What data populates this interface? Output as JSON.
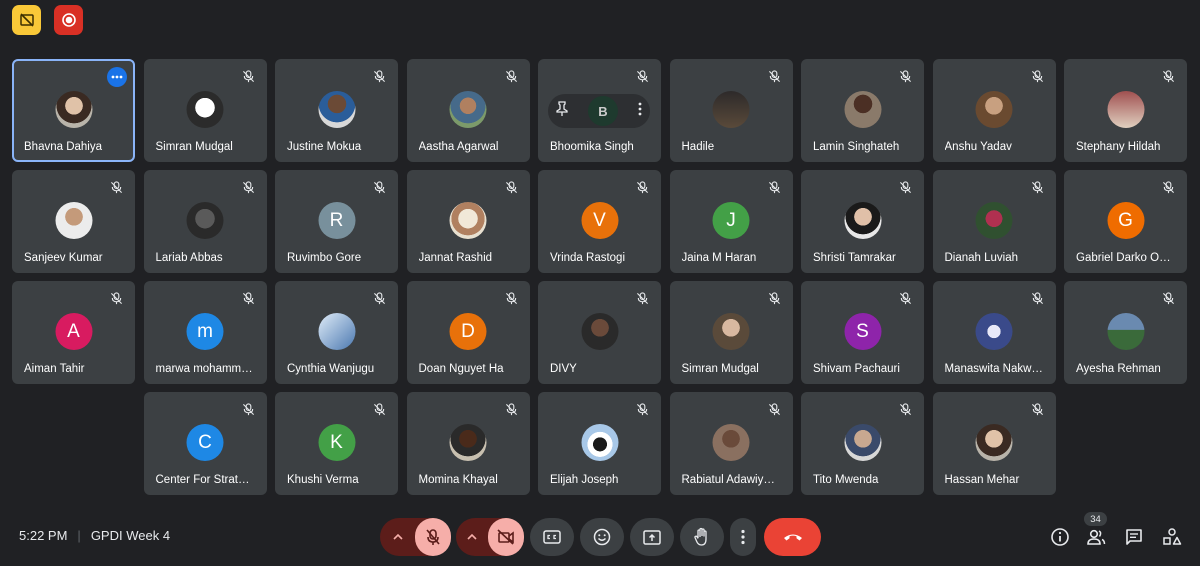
{
  "meeting": {
    "time": "5:22 PM",
    "title": "GPDI Week 4",
    "participant_count": "34"
  },
  "top_icons": {
    "left": "no-video-layout-icon",
    "right": "record-icon"
  },
  "colors": {
    "background": "#202124",
    "tile": "#3c4043",
    "active_border": "#8ab4f8",
    "leave": "#ea4335",
    "record": "#d93025",
    "accent_yellow": "#f9c838"
  },
  "participants": [
    {
      "name": "Bhavna Dahiya",
      "type": "photo",
      "active": true
    },
    {
      "name": "Simran Mudgal",
      "type": "photo"
    },
    {
      "name": "Justine Mokua",
      "type": "photo"
    },
    {
      "name": "Aastha Agarwal",
      "type": "photo"
    },
    {
      "name": "Bhoomika Singh",
      "type": "hover",
      "initial": "B"
    },
    {
      "name": "Hadile",
      "type": "photo"
    },
    {
      "name": "Lamin Singhateh",
      "type": "photo"
    },
    {
      "name": "Anshu Yadav",
      "type": "photo"
    },
    {
      "name": "Stephany Hildah",
      "type": "photo"
    },
    {
      "name": "Sanjeev Kumar",
      "type": "photo"
    },
    {
      "name": "Lariab Abbas",
      "type": "photo"
    },
    {
      "name": "Ruvimbo Gore",
      "type": "letter",
      "initial": "R",
      "color": "#78909c"
    },
    {
      "name": "Jannat Rashid",
      "type": "photo"
    },
    {
      "name": "Vrinda Rastogi",
      "type": "letter",
      "initial": "V",
      "color": "#e8710a"
    },
    {
      "name": "Jaina M Haran",
      "type": "letter",
      "initial": "J",
      "color": "#43a047"
    },
    {
      "name": "Shristi Tamrakar",
      "type": "photo"
    },
    {
      "name": "Dianah Luviah",
      "type": "photo"
    },
    {
      "name": "Gabriel Darko O…",
      "type": "letter",
      "initial": "G",
      "color": "#ef6c00"
    },
    {
      "name": "Aiman Tahir",
      "type": "letter",
      "initial": "A",
      "color": "#d81b60"
    },
    {
      "name": "marwa mohamm…",
      "type": "letter",
      "initial": "m",
      "color": "#1e88e5"
    },
    {
      "name": "Cynthia Wanjugu",
      "type": "photo"
    },
    {
      "name": "Doan Nguyet Ha",
      "type": "letter",
      "initial": "D",
      "color": "#e8710a"
    },
    {
      "name": "DIVY",
      "type": "photo"
    },
    {
      "name": "Simran Mudgal",
      "type": "photo"
    },
    {
      "name": "Shivam Pachauri",
      "type": "letter",
      "initial": "S",
      "color": "#8e24aa"
    },
    {
      "name": "Manaswita Nakw…",
      "type": "photo"
    },
    {
      "name": "Ayesha Rehman",
      "type": "photo"
    },
    {
      "name": "Center For Strat…",
      "type": "letter",
      "initial": "C",
      "color": "#1e88e5"
    },
    {
      "name": "Khushi Verma",
      "type": "letter",
      "initial": "K",
      "color": "#43a047"
    },
    {
      "name": "Momina Khayal",
      "type": "photo"
    },
    {
      "name": "Elijah Joseph",
      "type": "photo"
    },
    {
      "name": "Rabiatul Adawiy…",
      "type": "photo"
    },
    {
      "name": "Tito Mwenda",
      "type": "photo"
    },
    {
      "name": "Hassan Mehar",
      "type": "photo"
    }
  ],
  "controls": [
    {
      "name": "mic-options-chevron-icon"
    },
    {
      "name": "mic-off-icon"
    },
    {
      "name": "camera-options-chevron-icon"
    },
    {
      "name": "camera-off-icon"
    },
    {
      "name": "captions-icon"
    },
    {
      "name": "emoji-icon"
    },
    {
      "name": "present-screen-icon"
    },
    {
      "name": "raise-hand-icon"
    },
    {
      "name": "more-options-icon"
    },
    {
      "name": "leave-call-icon"
    }
  ],
  "right_controls": [
    {
      "name": "meeting-info-icon"
    },
    {
      "name": "people-icon"
    },
    {
      "name": "chat-icon"
    },
    {
      "name": "activities-icon"
    }
  ]
}
